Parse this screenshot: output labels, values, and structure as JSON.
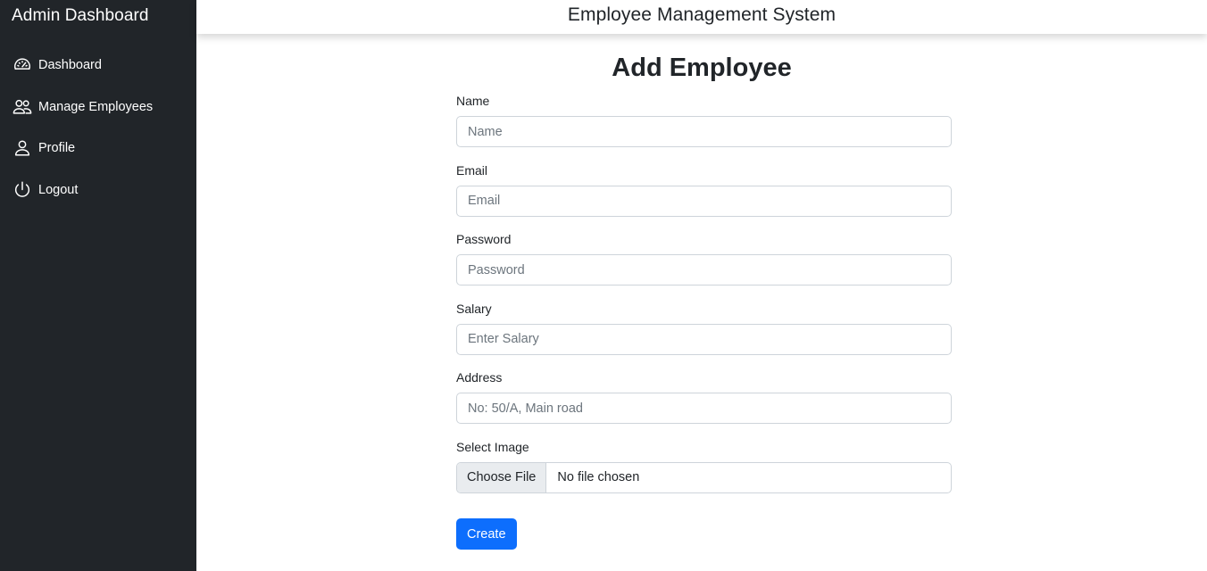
{
  "sidebar": {
    "title": "Admin Dashboard",
    "items": [
      {
        "label": "Dashboard",
        "icon": "speedometer-icon"
      },
      {
        "label": "Manage Employees",
        "icon": "people-icon"
      },
      {
        "label": "Profile",
        "icon": "person-icon"
      },
      {
        "label": "Logout",
        "icon": "power-icon"
      }
    ]
  },
  "header": {
    "title": "Employee Management System"
  },
  "form": {
    "title": "Add Employee",
    "fields": {
      "name": {
        "label": "Name",
        "placeholder": "Name",
        "value": ""
      },
      "email": {
        "label": "Email",
        "placeholder": "Email",
        "value": ""
      },
      "password": {
        "label": "Password",
        "placeholder": "Password",
        "value": ""
      },
      "salary": {
        "label": "Salary",
        "placeholder": "Enter Salary",
        "value": ""
      },
      "address": {
        "label": "Address",
        "placeholder": "No: 50/A, Main road",
        "value": ""
      }
    },
    "image": {
      "label": "Select Image",
      "button_label": "Choose File",
      "status": "No file chosen"
    },
    "submit_label": "Create"
  },
  "colors": {
    "sidebar_bg": "#212529",
    "primary": "#0d6efd",
    "input_border": "#ced4da"
  }
}
